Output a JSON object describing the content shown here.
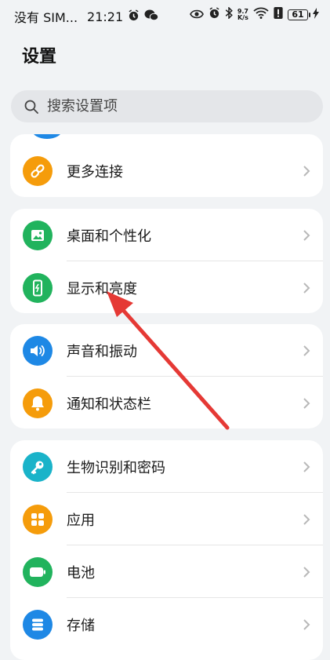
{
  "status_bar": {
    "carrier": "没有 SIM...",
    "time": "21:21",
    "net_speed_value": "9.7",
    "net_speed_unit": "K/s",
    "battery_level": "61"
  },
  "page_title": "设置",
  "search": {
    "placeholder": "搜索设置项"
  },
  "groups": [
    {
      "items": [
        {
          "label": "更多连接",
          "icon": "link-icon",
          "color": "#f59c0b"
        }
      ]
    },
    {
      "items": [
        {
          "label": "桌面和个性化",
          "icon": "image-icon",
          "color": "#21b35d"
        },
        {
          "label": "显示和亮度",
          "icon": "phone-brightness-icon",
          "color": "#21b35d"
        }
      ]
    },
    {
      "items": [
        {
          "label": "声音和振动",
          "icon": "speaker-icon",
          "color": "#1e88e5"
        },
        {
          "label": "通知和状态栏",
          "icon": "bell-icon",
          "color": "#f59c0b"
        }
      ]
    },
    {
      "items": [
        {
          "label": "生物识别和密码",
          "icon": "key-icon",
          "color": "#1ab3c9"
        },
        {
          "label": "应用",
          "icon": "apps-grid-icon",
          "color": "#f59c0b"
        },
        {
          "label": "电池",
          "icon": "battery-icon",
          "color": "#21b35d"
        },
        {
          "label": "存储",
          "icon": "storage-icon",
          "color": "#1e88e5"
        }
      ]
    }
  ],
  "annotation": {
    "color": "#e53935",
    "points_to": "显示和亮度"
  }
}
